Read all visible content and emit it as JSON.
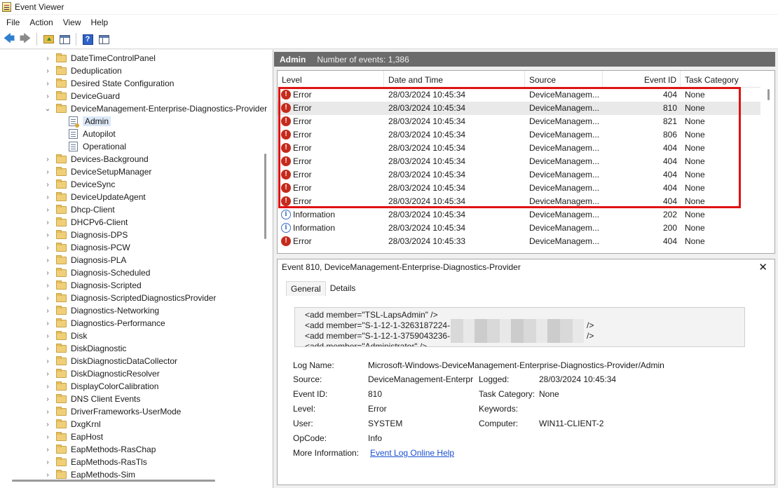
{
  "window": {
    "title": "Event Viewer"
  },
  "menu": [
    "File",
    "Action",
    "View",
    "Help"
  ],
  "toolbar": {
    "help_glyph": "?"
  },
  "tree": [
    {
      "label": "DateTimeControlPanel",
      "type": "folder",
      "chev": "›"
    },
    {
      "label": "Deduplication",
      "type": "folder",
      "chev": "›"
    },
    {
      "label": "Desired State Configuration",
      "type": "folder",
      "chev": "›"
    },
    {
      "label": "DeviceGuard",
      "type": "folder",
      "chev": "›"
    },
    {
      "label": "DeviceManagement-Enterprise-Diagnostics-Provider",
      "type": "folder",
      "chev": "⌄",
      "expanded": true
    },
    {
      "label": "Admin",
      "type": "log",
      "selected": true
    },
    {
      "label": "Autopilot",
      "type": "log"
    },
    {
      "label": "Operational",
      "type": "log"
    },
    {
      "label": "Devices-Background",
      "type": "folder",
      "chev": "›"
    },
    {
      "label": "DeviceSetupManager",
      "type": "folder",
      "chev": "›"
    },
    {
      "label": "DeviceSync",
      "type": "folder",
      "chev": "›"
    },
    {
      "label": "DeviceUpdateAgent",
      "type": "folder",
      "chev": "›"
    },
    {
      "label": "Dhcp-Client",
      "type": "folder",
      "chev": "›"
    },
    {
      "label": "DHCPv6-Client",
      "type": "folder",
      "chev": "›"
    },
    {
      "label": "Diagnosis-DPS",
      "type": "folder",
      "chev": "›"
    },
    {
      "label": "Diagnosis-PCW",
      "type": "folder",
      "chev": "›"
    },
    {
      "label": "Diagnosis-PLA",
      "type": "folder",
      "chev": "›"
    },
    {
      "label": "Diagnosis-Scheduled",
      "type": "folder",
      "chev": "›"
    },
    {
      "label": "Diagnosis-Scripted",
      "type": "folder",
      "chev": "›"
    },
    {
      "label": "Diagnosis-ScriptedDiagnosticsProvider",
      "type": "folder",
      "chev": "›"
    },
    {
      "label": "Diagnostics-Networking",
      "type": "folder",
      "chev": "›"
    },
    {
      "label": "Diagnostics-Performance",
      "type": "folder",
      "chev": "›"
    },
    {
      "label": "Disk",
      "type": "folder",
      "chev": "›"
    },
    {
      "label": "DiskDiagnostic",
      "type": "folder",
      "chev": "›"
    },
    {
      "label": "DiskDiagnosticDataCollector",
      "type": "folder",
      "chev": "›"
    },
    {
      "label": "DiskDiagnosticResolver",
      "type": "folder",
      "chev": "›"
    },
    {
      "label": "DisplayColorCalibration",
      "type": "folder",
      "chev": "›"
    },
    {
      "label": "DNS Client Events",
      "type": "folder",
      "chev": "›"
    },
    {
      "label": "DriverFrameworks-UserMode",
      "type": "folder",
      "chev": "›"
    },
    {
      "label": "DxgKrnl",
      "type": "folder",
      "chev": "›"
    },
    {
      "label": "EapHost",
      "type": "folder",
      "chev": "›"
    },
    {
      "label": "EapMethods-RasChap",
      "type": "folder",
      "chev": "›"
    },
    {
      "label": "EapMethods-RasTls",
      "type": "folder",
      "chev": "›"
    },
    {
      "label": "EapMethods-Sim",
      "type": "folder",
      "chev": "›"
    }
  ],
  "log_header": {
    "name": "Admin",
    "count": "Number of events: 1,386"
  },
  "columns": [
    "Level",
    "Date and Time",
    "Source",
    "Event ID",
    "Task Category"
  ],
  "events": [
    {
      "level": "Error",
      "date": "28/03/2024 10:45:34",
      "source": "DeviceManagem...",
      "id": "404",
      "task": "None"
    },
    {
      "level": "Error",
      "date": "28/03/2024 10:45:34",
      "source": "DeviceManagem...",
      "id": "810",
      "task": "None",
      "highlight": true
    },
    {
      "level": "Error",
      "date": "28/03/2024 10:45:34",
      "source": "DeviceManagem...",
      "id": "821",
      "task": "None"
    },
    {
      "level": "Error",
      "date": "28/03/2024 10:45:34",
      "source": "DeviceManagem...",
      "id": "806",
      "task": "None"
    },
    {
      "level": "Error",
      "date": "28/03/2024 10:45:34",
      "source": "DeviceManagem...",
      "id": "404",
      "task": "None"
    },
    {
      "level": "Error",
      "date": "28/03/2024 10:45:34",
      "source": "DeviceManagem...",
      "id": "404",
      "task": "None"
    },
    {
      "level": "Error",
      "date": "28/03/2024 10:45:34",
      "source": "DeviceManagem...",
      "id": "404",
      "task": "None"
    },
    {
      "level": "Error",
      "date": "28/03/2024 10:45:34",
      "source": "DeviceManagem...",
      "id": "404",
      "task": "None"
    },
    {
      "level": "Error",
      "date": "28/03/2024 10:45:34",
      "source": "DeviceManagem...",
      "id": "404",
      "task": "None"
    },
    {
      "level": "Information",
      "date": "28/03/2024 10:45:34",
      "source": "DeviceManagem...",
      "id": "202",
      "task": "None"
    },
    {
      "level": "Information",
      "date": "28/03/2024 10:45:34",
      "source": "DeviceManagem...",
      "id": "200",
      "task": "None"
    },
    {
      "level": "Error",
      "date": "28/03/2024 10:45:33",
      "source": "DeviceManagem...",
      "id": "404",
      "task": "None"
    }
  ],
  "detail": {
    "title": "Event 810, DeviceManagement-Enterprise-Diagnostics-Provider",
    "close": "✕",
    "tabs": [
      "General",
      "Details"
    ],
    "xml_lines": [
      "<add member=\"TSL-LapsAdmin\" />",
      "<add member=\"S-1-12-1-3263187224-",
      "<add member=\"S-1-12-1-3759043236-",
      "<add member=\"Administrator\" />"
    ],
    "xml_tail": "/>",
    "props": {
      "log_name_label": "Log Name:",
      "log_name": "Microsoft-Windows-DeviceManagement-Enterprise-Diagnostics-Provider/Admin",
      "source_label": "Source:",
      "source": "DeviceManagement-Enterpr",
      "logged_label": "Logged:",
      "logged": "28/03/2024 10:45:34",
      "event_id_label": "Event ID:",
      "event_id": "810",
      "task_label": "Task Category:",
      "task": "None",
      "level_label": "Level:",
      "level": "Error",
      "keywords_label": "Keywords:",
      "keywords": "",
      "user_label": "User:",
      "user": "SYSTEM",
      "computer_label": "Computer:",
      "computer": "WIN11-CLIENT-2",
      "opcode_label": "OpCode:",
      "opcode": "Info",
      "more_label": "More Information:",
      "more_link": "Event Log Online Help"
    }
  },
  "colors": {
    "error": "#c42b1c",
    "info": "#3b6fc2",
    "annotation": "#e01313",
    "header_bar": "#6b6b6b",
    "link": "#1a4fcf"
  }
}
